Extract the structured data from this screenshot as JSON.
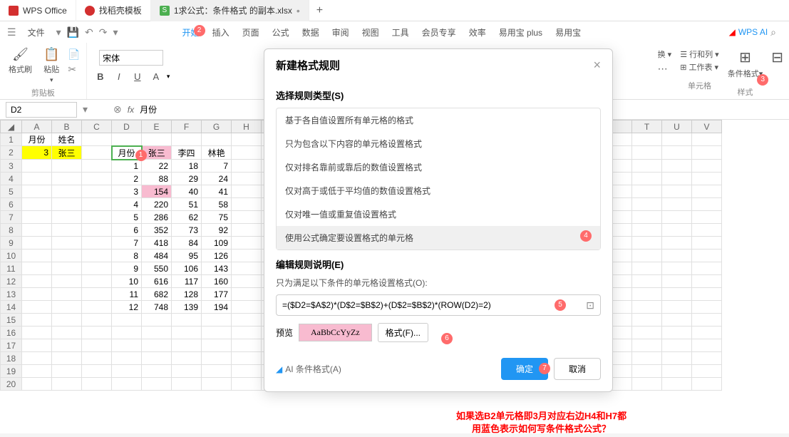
{
  "tabs": {
    "t0": "WPS Office",
    "t1": "找稻壳模板",
    "t2": "1求公式：条件格式 的副本.xlsx",
    "plus": "+"
  },
  "fileMenu": "文件",
  "menus": {
    "m0": "开始",
    "m1": "插入",
    "m2": "页面",
    "m3": "公式",
    "m4": "数据",
    "m5": "审阅",
    "m6": "视图",
    "m7": "工具",
    "m8": "会员专享",
    "m9": "效率",
    "m10": "易用宝 plus",
    "m11": "易用宝"
  },
  "wpsai": "WPS AI",
  "toolbar": {
    "formatPainter": "格式刷",
    "paste": "粘贴",
    "clipboard": "剪贴板",
    "fontName": "宋体",
    "bold": "B",
    "italic": "I",
    "underline": "U",
    "more": "A",
    "replace": "换",
    "rowcol": "行和列",
    "worksheet": "工作表",
    "cells": "单元格",
    "condfmt": "条件格式",
    "styles": "样式"
  },
  "cellref": {
    "ref": "D2",
    "fx": "fx",
    "formula": "月份"
  },
  "search_icon": "⌕",
  "sheet": {
    "cols": [
      "A",
      "B",
      "C",
      "D",
      "E",
      "F",
      "G",
      "H",
      "T",
      "U",
      "V"
    ],
    "rows": [
      "1",
      "2",
      "3",
      "4",
      "5",
      "6",
      "7",
      "8",
      "9",
      "10",
      "11",
      "12",
      "13",
      "14",
      "15",
      "16",
      "17",
      "18",
      "19",
      "20"
    ],
    "A1": "月份",
    "B1": "姓名",
    "A2": "3",
    "B2": "张三",
    "D2": "月份",
    "E2": "张三",
    "F2": "李四",
    "G2": "林艳",
    "data": [
      {
        "D": "1",
        "E": "22",
        "F": "18",
        "G": "7"
      },
      {
        "D": "2",
        "E": "88",
        "F": "29",
        "G": "24"
      },
      {
        "D": "3",
        "E": "154",
        "F": "40",
        "G": "41"
      },
      {
        "D": "4",
        "E": "220",
        "F": "51",
        "G": "58"
      },
      {
        "D": "5",
        "E": "286",
        "F": "62",
        "G": "75"
      },
      {
        "D": "6",
        "E": "352",
        "F": "73",
        "G": "92"
      },
      {
        "D": "7",
        "E": "418",
        "F": "84",
        "G": "109"
      },
      {
        "D": "8",
        "E": "484",
        "F": "95",
        "G": "126"
      },
      {
        "D": "9",
        "E": "550",
        "F": "106",
        "G": "143"
      },
      {
        "D": "10",
        "E": "616",
        "F": "117",
        "G": "160"
      },
      {
        "D": "11",
        "E": "682",
        "F": "128",
        "G": "177"
      },
      {
        "D": "12",
        "E": "748",
        "F": "139",
        "G": "194"
      }
    ]
  },
  "dialog": {
    "title": "新建格式规则",
    "close": "×",
    "section1": "选择规则类型(S)",
    "rules": {
      "r0": "基于各自值设置所有单元格的格式",
      "r1": "只为包含以下内容的单元格设置格式",
      "r2": "仅对排名靠前或靠后的数值设置格式",
      "r3": "仅对高于或低于平均值的数值设置格式",
      "r4": "仅对唯一值或重复值设置格式",
      "r5": "使用公式确定要设置格式的单元格"
    },
    "section2": "编辑规则说明(E)",
    "desc": "只为满足以下条件的单元格设置格式(O):",
    "formula": "=($D2=$A$2)*(D$2=$B$2)+(D$2=$B$2)*(ROW(D2)=2)",
    "preview_label": "预览",
    "preview_text": "AaBbCcYyZz",
    "format_btn": "格式(F)...",
    "ai_link": "AI 条件格式(A)",
    "ok": "确定",
    "cancel": "取消"
  },
  "badges": {
    "b1": "1",
    "b2": "2",
    "b3": "3",
    "b4": "4",
    "b5": "5",
    "b6": "6",
    "b7": "7"
  },
  "note": {
    "line1": "如果选B2单元格即3月对应右边H4和H7都",
    "line2": "用蓝色表示如何写条件格式公式？"
  }
}
